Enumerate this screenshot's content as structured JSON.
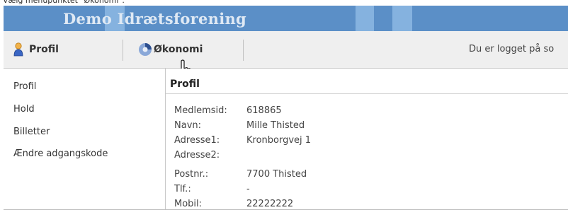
{
  "caption": "Vælg menupunktet \"Økonomi\".",
  "header": {
    "title": "Demo Idrætsforening"
  },
  "menu": {
    "items": [
      {
        "label": "Profil",
        "icon": "user-icon"
      },
      {
        "label": "Økonomi",
        "icon": "swirl-icon"
      }
    ],
    "login_text": "Du er logget på so"
  },
  "sidebar": {
    "items": [
      "Profil",
      "Hold",
      "Billetter",
      "Ændre adgangskode"
    ]
  },
  "profile": {
    "title": "Profil",
    "fields": [
      {
        "label": "Medlemsid:",
        "value": "618865"
      },
      {
        "label": "Navn:",
        "value": "Mille Thisted"
      },
      {
        "label": "Adresse1:",
        "value": "Kronborgvej 1"
      },
      {
        "label": "Adresse2:",
        "value": ""
      },
      {
        "label": "Postnr.:",
        "value": "7700 Thisted"
      },
      {
        "label": "Tlf.:",
        "value": "-"
      },
      {
        "label": "Mobil:",
        "value": "22222222"
      }
    ]
  },
  "colors": {
    "banner": "#5b8fc7",
    "banner_text": "#dfe9f4",
    "menubar": "#efefef"
  }
}
